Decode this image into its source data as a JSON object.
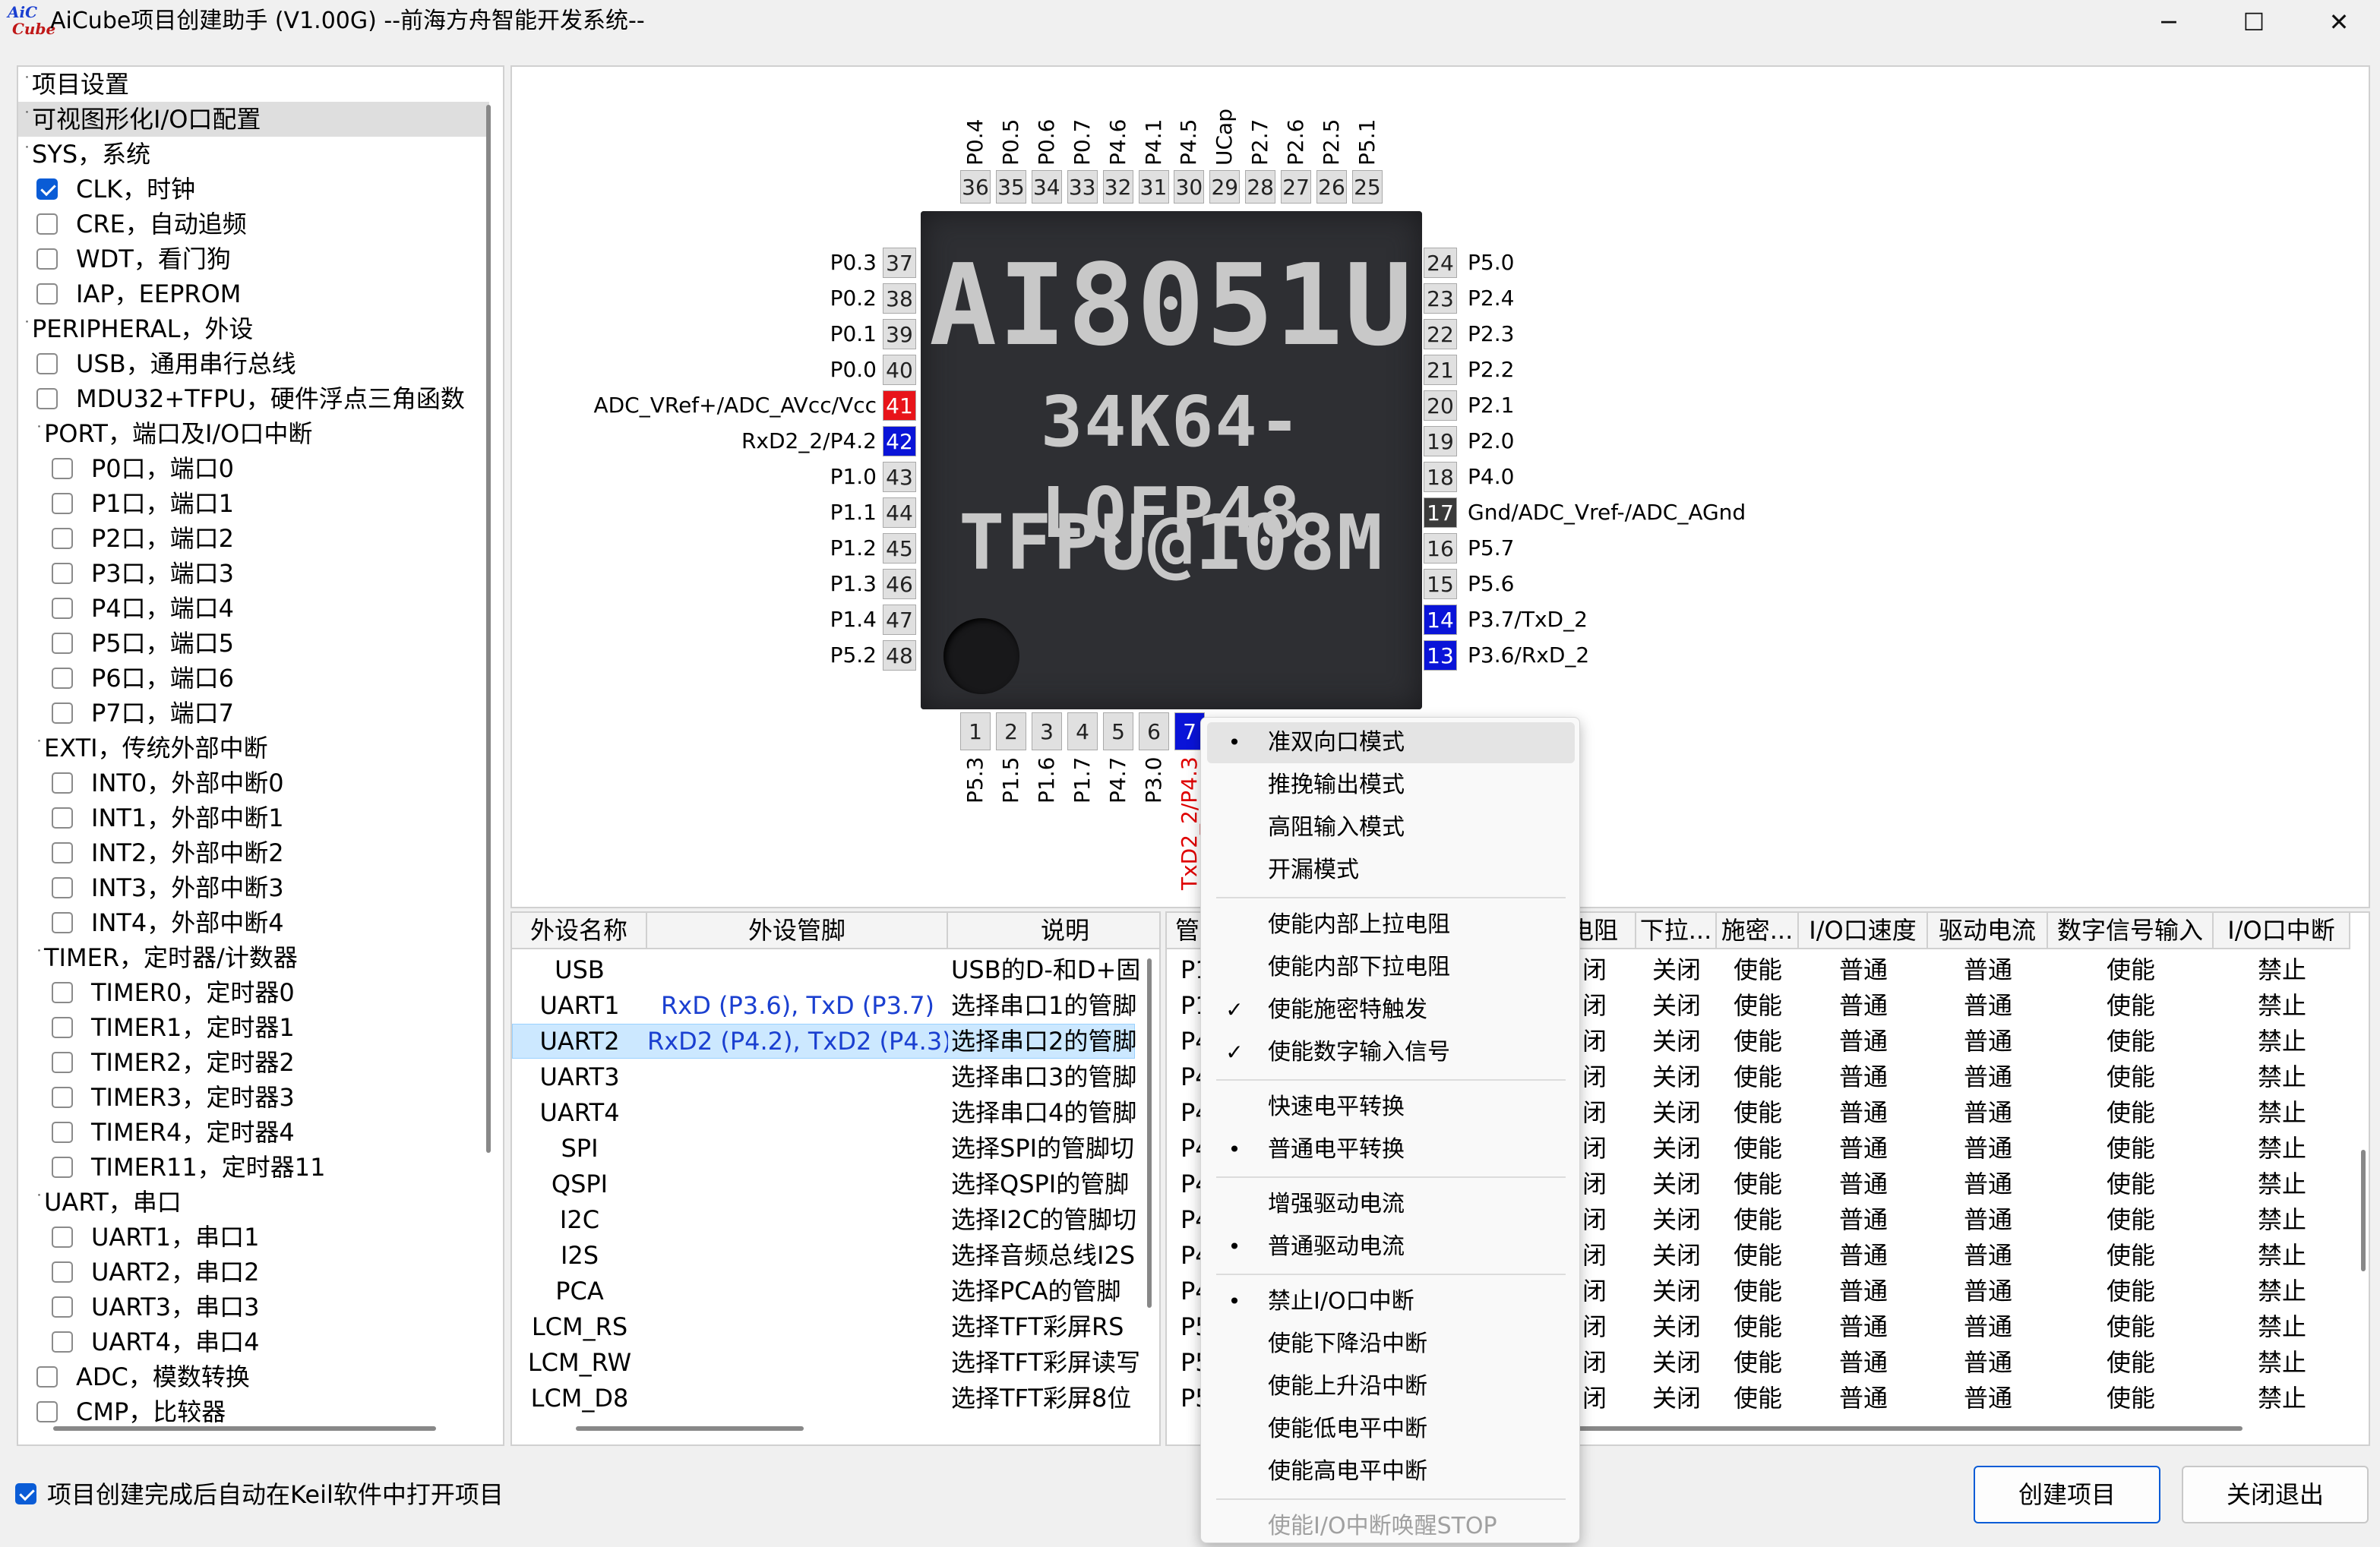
{
  "window": {
    "title": "AiCube项目创建助手 (V1.00G) --前海方舟智能开发系统--",
    "logo_top": "AiC",
    "logo_bottom": "Cube",
    "minimize": "─",
    "maximize": "☐",
    "close": "✕"
  },
  "tree": {
    "items": [
      {
        "label": "项目设置",
        "level": 0,
        "check": "none"
      },
      {
        "label": "可视图形化I/O口配置",
        "level": 0,
        "check": "none",
        "selected": true
      },
      {
        "label": "SYS，系统",
        "level": 0,
        "check": "none"
      },
      {
        "label": "CLK，时钟",
        "level": 1,
        "check": "on"
      },
      {
        "label": "CRE，自动追频",
        "level": 1,
        "check": "off"
      },
      {
        "label": "WDT，看门狗",
        "level": 1,
        "check": "off"
      },
      {
        "label": "IAP，EEPROM",
        "level": 1,
        "check": "off"
      },
      {
        "label": "PERIPHERAL，外设",
        "level": 0,
        "check": "none"
      },
      {
        "label": "USB，通用串行总线",
        "level": 1,
        "check": "off"
      },
      {
        "label": "MDU32+TFPU，硬件浮点三角函数",
        "level": 1,
        "check": "off"
      },
      {
        "label": "PORT，端口及I/O口中断",
        "level": 1,
        "check": "none"
      },
      {
        "label": "P0口，端口0",
        "level": 2,
        "check": "off"
      },
      {
        "label": "P1口，端口1",
        "level": 2,
        "check": "off"
      },
      {
        "label": "P2口，端口2",
        "level": 2,
        "check": "off"
      },
      {
        "label": "P3口，端口3",
        "level": 2,
        "check": "off"
      },
      {
        "label": "P4口，端口4",
        "level": 2,
        "check": "off"
      },
      {
        "label": "P5口，端口5",
        "level": 2,
        "check": "off"
      },
      {
        "label": "P6口，端口6",
        "level": 2,
        "check": "off"
      },
      {
        "label": "P7口，端口7",
        "level": 2,
        "check": "off"
      },
      {
        "label": "EXTI，传统外部中断",
        "level": 1,
        "check": "none"
      },
      {
        "label": "INT0，外部中断0",
        "level": 2,
        "check": "off"
      },
      {
        "label": "INT1，外部中断1",
        "level": 2,
        "check": "off"
      },
      {
        "label": "INT2，外部中断2",
        "level": 2,
        "check": "off"
      },
      {
        "label": "INT3，外部中断3",
        "level": 2,
        "check": "off"
      },
      {
        "label": "INT4，外部中断4",
        "level": 2,
        "check": "off"
      },
      {
        "label": "TIMER，定时器/计数器",
        "level": 1,
        "check": "none"
      },
      {
        "label": "TIMER0，定时器0",
        "level": 2,
        "check": "off"
      },
      {
        "label": "TIMER1，定时器1",
        "level": 2,
        "check": "off"
      },
      {
        "label": "TIMER2，定时器2",
        "level": 2,
        "check": "off"
      },
      {
        "label": "TIMER3，定时器3",
        "level": 2,
        "check": "off"
      },
      {
        "label": "TIMER4，定时器4",
        "level": 2,
        "check": "off"
      },
      {
        "label": "TIMER11，定时器11",
        "level": 2,
        "check": "off"
      },
      {
        "label": "UART，串口",
        "level": 1,
        "check": "none"
      },
      {
        "label": "UART1，串口1",
        "level": 2,
        "check": "off"
      },
      {
        "label": "UART2，串口2",
        "level": 2,
        "check": "off"
      },
      {
        "label": "UART3，串口3",
        "level": 2,
        "check": "off"
      },
      {
        "label": "UART4，串口4",
        "level": 2,
        "check": "off"
      },
      {
        "label": "ADC，模数转换",
        "level": 1,
        "check": "off"
      },
      {
        "label": "CMP，比较器",
        "level": 1,
        "check": "off"
      }
    ]
  },
  "chip": {
    "line1": "AI8051U",
    "line2": "34K64-LQFP48",
    "line3": "TFPU@108M",
    "top_pins": [
      {
        "num": "36",
        "label": "P0.4"
      },
      {
        "num": "35",
        "label": "P0.5"
      },
      {
        "num": "34",
        "label": "P0.6"
      },
      {
        "num": "33",
        "label": "P0.7"
      },
      {
        "num": "32",
        "label": "P4.6"
      },
      {
        "num": "31",
        "label": "P4.1"
      },
      {
        "num": "30",
        "label": "P4.5"
      },
      {
        "num": "29",
        "label": "UCap"
      },
      {
        "num": "28",
        "label": "P2.7"
      },
      {
        "num": "27",
        "label": "P2.6"
      },
      {
        "num": "26",
        "label": "P2.5"
      },
      {
        "num": "25",
        "label": "P5.1"
      }
    ],
    "left_pins": [
      {
        "num": "37",
        "label": "P0.3",
        "color": "gray"
      },
      {
        "num": "38",
        "label": "P0.2",
        "color": "gray"
      },
      {
        "num": "39",
        "label": "P0.1",
        "color": "gray"
      },
      {
        "num": "40",
        "label": "P0.0",
        "color": "gray"
      },
      {
        "num": "41",
        "label": "ADC_VRef+/ADC_AVcc/Vcc",
        "color": "red"
      },
      {
        "num": "42",
        "label": "RxD2_2/P4.2",
        "color": "blue"
      },
      {
        "num": "43",
        "label": "P1.0",
        "color": "gray"
      },
      {
        "num": "44",
        "label": "P1.1",
        "color": "gray"
      },
      {
        "num": "45",
        "label": "P1.2",
        "color": "gray"
      },
      {
        "num": "46",
        "label": "P1.3",
        "color": "gray"
      },
      {
        "num": "47",
        "label": "P1.4",
        "color": "gray"
      },
      {
        "num": "48",
        "label": "P5.2",
        "color": "gray"
      }
    ],
    "right_pins": [
      {
        "num": "24",
        "label": "P5.0",
        "color": "gray"
      },
      {
        "num": "23",
        "label": "P2.4",
        "color": "gray"
      },
      {
        "num": "22",
        "label": "P2.3",
        "color": "gray"
      },
      {
        "num": "21",
        "label": "P2.2",
        "color": "gray"
      },
      {
        "num": "20",
        "label": "P2.1",
        "color": "gray"
      },
      {
        "num": "19",
        "label": "P2.0",
        "color": "gray"
      },
      {
        "num": "18",
        "label": "P4.0",
        "color": "gray"
      },
      {
        "num": "17",
        "label": "Gnd/ADC_Vref-/ADC_AGnd",
        "color": "dark"
      },
      {
        "num": "16",
        "label": "P5.7",
        "color": "gray"
      },
      {
        "num": "15",
        "label": "P5.6",
        "color": "gray"
      },
      {
        "num": "14",
        "label": "P3.7/TxD_2",
        "color": "blue"
      },
      {
        "num": "13",
        "label": "P3.6/RxD_2",
        "color": "blue"
      }
    ],
    "bottom_pins": [
      {
        "num": "1",
        "label": "P5.3",
        "color": "gray"
      },
      {
        "num": "2",
        "label": "P1.5",
        "color": "gray"
      },
      {
        "num": "3",
        "label": "P1.6",
        "color": "gray"
      },
      {
        "num": "4",
        "label": "P1.7",
        "color": "gray"
      },
      {
        "num": "5",
        "label": "P4.7",
        "color": "gray"
      },
      {
        "num": "6",
        "label": "P3.0",
        "color": "gray"
      },
      {
        "num": "7",
        "label": "TxD2_2/P4.3",
        "color": "blue"
      }
    ]
  },
  "periph_table": {
    "headers": [
      "外设名称",
      "外设管脚",
      "说明"
    ],
    "rows": [
      {
        "name": "USB",
        "pins": "",
        "desc": "USB的D-和D+固"
      },
      {
        "name": "UART1",
        "pins": "RxD (P3.6), TxD (P3.7)",
        "desc": "选择串口1的管脚"
      },
      {
        "name": "UART2",
        "pins": "RxD2 (P4.2), TxD2 (P4.3)",
        "desc": "选择串口2的管脚",
        "selected": true
      },
      {
        "name": "UART3",
        "pins": "",
        "desc": "选择串口3的管脚"
      },
      {
        "name": "UART4",
        "pins": "",
        "desc": "选择串口4的管脚"
      },
      {
        "name": "SPI",
        "pins": "",
        "desc": "选择SPI的管脚切"
      },
      {
        "name": "QSPI",
        "pins": "",
        "desc": "选择QSPI的管脚"
      },
      {
        "name": "I2C",
        "pins": "",
        "desc": "选择I2C的管脚切"
      },
      {
        "name": "I2S",
        "pins": "",
        "desc": "选择音频总线I2S"
      },
      {
        "name": "PCA",
        "pins": "",
        "desc": "选择PCA的管脚"
      },
      {
        "name": "LCM_RS",
        "pins": "",
        "desc": "选择TFT彩屏RS"
      },
      {
        "name": "LCM_RW",
        "pins": "",
        "desc": "选择TFT彩屏读写"
      },
      {
        "name": "LCM_D8",
        "pins": "",
        "desc": "选择TFT彩屏8位"
      }
    ]
  },
  "pin_table": {
    "headers": [
      "管",
      "电阻",
      "下拉...",
      "施密...",
      "I/O口速度",
      "驱动电流",
      "数字信号输入",
      "I/O口中断"
    ],
    "rows": [
      {
        "pin": "P1",
        "pu": "闭",
        "pd": "关闭",
        "st": "使能",
        "speed": "普通",
        "drive": "普通",
        "din": "使能",
        "irq": "禁止"
      },
      {
        "pin": "P1",
        "pu": "闭",
        "pd": "关闭",
        "st": "使能",
        "speed": "普通",
        "drive": "普通",
        "din": "使能",
        "irq": "禁止"
      },
      {
        "pin": "P4",
        "pu": "闭",
        "pd": "关闭",
        "st": "使能",
        "speed": "普通",
        "drive": "普通",
        "din": "使能",
        "irq": "禁止"
      },
      {
        "pin": "P4",
        "pu": "闭",
        "pd": "关闭",
        "st": "使能",
        "speed": "普通",
        "drive": "普通",
        "din": "使能",
        "irq": "禁止"
      },
      {
        "pin": "P4",
        "pu": "闭",
        "pd": "关闭",
        "st": "使能",
        "speed": "普通",
        "drive": "普通",
        "din": "使能",
        "irq": "禁止"
      },
      {
        "pin": "P4",
        "pu": "闭",
        "pd": "关闭",
        "st": "使能",
        "speed": "普通",
        "drive": "普通",
        "din": "使能",
        "irq": "禁止"
      },
      {
        "pin": "P4",
        "pu": "闭",
        "pd": "关闭",
        "st": "使能",
        "speed": "普通",
        "drive": "普通",
        "din": "使能",
        "irq": "禁止"
      },
      {
        "pin": "P4",
        "pu": "闭",
        "pd": "关闭",
        "st": "使能",
        "speed": "普通",
        "drive": "普通",
        "din": "使能",
        "irq": "禁止"
      },
      {
        "pin": "P4",
        "pu": "闭",
        "pd": "关闭",
        "st": "使能",
        "speed": "普通",
        "drive": "普通",
        "din": "使能",
        "irq": "禁止"
      },
      {
        "pin": "P4",
        "pu": "闭",
        "pd": "关闭",
        "st": "使能",
        "speed": "普通",
        "drive": "普通",
        "din": "使能",
        "irq": "禁止"
      },
      {
        "pin": "P5",
        "pu": "闭",
        "pd": "关闭",
        "st": "使能",
        "speed": "普通",
        "drive": "普通",
        "din": "使能",
        "irq": "禁止"
      },
      {
        "pin": "P5",
        "pu": "闭",
        "pd": "关闭",
        "st": "使能",
        "speed": "普通",
        "drive": "普通",
        "din": "使能",
        "irq": "禁止"
      },
      {
        "pin": "P5",
        "pu": "闭",
        "pd": "关闭",
        "st": "使能",
        "speed": "普通",
        "drive": "普通",
        "din": "使能",
        "irq": "禁止"
      }
    ]
  },
  "context_menu": {
    "items": [
      {
        "label": "准双向口模式",
        "mark": "•",
        "highlighted": true
      },
      {
        "label": "推挽输出模式",
        "mark": ""
      },
      {
        "label": "高阻输入模式",
        "mark": ""
      },
      {
        "label": "开漏模式",
        "mark": ""
      },
      {
        "sep": true
      },
      {
        "label": "使能内部上拉电阻",
        "mark": ""
      },
      {
        "label": "使能内部下拉电阻",
        "mark": ""
      },
      {
        "label": "使能施密特触发",
        "mark": "✓"
      },
      {
        "label": "使能数字输入信号",
        "mark": "✓"
      },
      {
        "sep": true
      },
      {
        "label": "快速电平转换",
        "mark": ""
      },
      {
        "label": "普通电平转换",
        "mark": "•"
      },
      {
        "sep": true
      },
      {
        "label": "增强驱动电流",
        "mark": ""
      },
      {
        "label": "普通驱动电流",
        "mark": "•"
      },
      {
        "sep": true
      },
      {
        "label": "禁止I/O口中断",
        "mark": "•"
      },
      {
        "label": "使能下降沿中断",
        "mark": ""
      },
      {
        "label": "使能上升沿中断",
        "mark": ""
      },
      {
        "label": "使能低电平中断",
        "mark": ""
      },
      {
        "label": "使能高电平中断",
        "mark": ""
      },
      {
        "sep": true
      },
      {
        "label": "使能I/O中断唤醒STOP",
        "mark": "",
        "disabled": true
      }
    ]
  },
  "footer": {
    "auto_open_label": "项目创建完成后自动在Keil软件中打开项目",
    "auto_open_checked": true,
    "create_button": "创建项目",
    "exit_button": "关闭退出"
  }
}
